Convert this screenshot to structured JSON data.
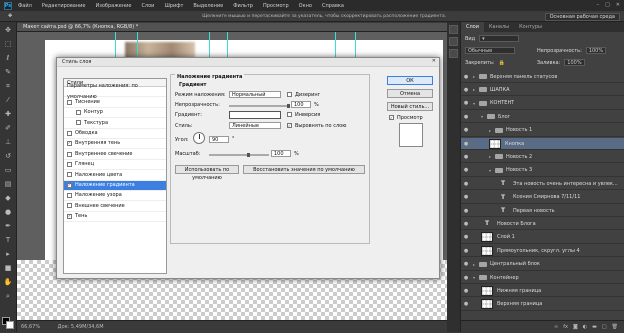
{
  "menu": {
    "logo": "Ps",
    "items": [
      "Файл",
      "Редактирование",
      "Изображение",
      "Слои",
      "Шрифт",
      "Выделение",
      "Фильтр",
      "Просмотр",
      "Окно",
      "Справка"
    ]
  },
  "options_bar": {
    "hint": "Щелкните мышью и перетаскивайте за указатель, чтобы скорректировать расположение градиента.",
    "workspace": "Основная рабочая среда"
  },
  "document": {
    "tab_title": "Макет сайта.psd @ 66,7% (Кнопка, RGB/8) *",
    "zoom": "66,67%",
    "doc_size": "Док: 5,49М/34,6М"
  },
  "panel": {
    "tabs": [
      "Слои",
      "Каналы",
      "Контуры"
    ],
    "kind_label": "Вид",
    "blend_mode": "Обычные",
    "opacity_label": "Непрозрачность:",
    "opacity": "100%",
    "lock_label": "Закрепить:",
    "fill_label": "Заливка:",
    "fill": "100%"
  },
  "layers": [
    {
      "name": "Верхняя панель статусов",
      "type": "folder",
      "level": 0,
      "collapsed": true
    },
    {
      "name": "ШАПКА",
      "type": "folder",
      "level": 0,
      "collapsed": true
    },
    {
      "name": "КОНТЕНТ",
      "type": "folder",
      "level": 0,
      "collapsed": false
    },
    {
      "name": "Блог",
      "type": "folder",
      "level": 1,
      "collapsed": false
    },
    {
      "name": "Новость 1",
      "type": "folder",
      "level": 2,
      "collapsed": true
    },
    {
      "name": "Кнопка",
      "type": "layer",
      "level": 2,
      "selected": true
    },
    {
      "name": "Новость 2",
      "type": "folder",
      "level": 2,
      "collapsed": true
    },
    {
      "name": "Новость 3",
      "type": "folder",
      "level": 2,
      "collapsed": false
    },
    {
      "name": "Эта новость очень интересна и увлек...",
      "type": "text",
      "level": 3
    },
    {
      "name": "Ксения Смирнова 7/11/11",
      "type": "text",
      "level": 3
    },
    {
      "name": "Первая новость",
      "type": "text",
      "level": 3
    },
    {
      "name": "Новости Блога",
      "type": "text",
      "level": 1
    },
    {
      "name": "Слой 1",
      "type": "layer",
      "level": 1
    },
    {
      "name": "Прямоугольник, скругл. углы 4",
      "type": "layer",
      "level": 1
    },
    {
      "name": "Центральный блок",
      "type": "folder",
      "level": 0,
      "collapsed": true
    },
    {
      "name": "Контейнер",
      "type": "folder",
      "level": 0,
      "collapsed": false
    },
    {
      "name": "Нижняя граница",
      "type": "layer",
      "level": 1
    },
    {
      "name": "Верхняя граница",
      "type": "layer",
      "level": 1
    }
  ],
  "dialog": {
    "title": "Стиль слоя",
    "list_header": "Стили",
    "styles": [
      {
        "label": "Параметры наложения: по умолчанию",
        "checkbox": false,
        "checked": false,
        "sub": false
      },
      {
        "label": "Тиснение",
        "checkbox": true,
        "checked": false,
        "sub": false
      },
      {
        "label": "Контур",
        "checkbox": true,
        "checked": false,
        "sub": true
      },
      {
        "label": "Текстура",
        "checkbox": true,
        "checked": false,
        "sub": true
      },
      {
        "label": "Обводка",
        "checkbox": true,
        "checked": false,
        "sub": false
      },
      {
        "label": "Внутренняя тень",
        "checkbox": true,
        "checked": true,
        "sub": false
      },
      {
        "label": "Внутреннее свечение",
        "checkbox": true,
        "checked": false,
        "sub": false
      },
      {
        "label": "Глянец",
        "checkbox": true,
        "checked": false,
        "sub": false
      },
      {
        "label": "Наложение цвета",
        "checkbox": true,
        "checked": false,
        "sub": false
      },
      {
        "label": "Наложение градиента",
        "checkbox": true,
        "checked": true,
        "sub": false,
        "selected": true
      },
      {
        "label": "Наложение узора",
        "checkbox": true,
        "checked": false,
        "sub": false
      },
      {
        "label": "Внешнее свечение",
        "checkbox": true,
        "checked": false,
        "sub": false
      },
      {
        "label": "Тень",
        "checkbox": true,
        "checked": true,
        "sub": false
      }
    ],
    "section_title": "Наложение градиента",
    "group_title": "Градиент",
    "blend_label": "Режим наложения:",
    "blend_value": "Нормальный",
    "dither_label": "Дизеринг",
    "opacity_label": "Непрозрачность:",
    "opacity_value": "100",
    "percent": "%",
    "gradient_label": "Градиент:",
    "inversion_label": "Инверсия",
    "style_label": "Стиль:",
    "style_value": "Линейные",
    "align_label": "Выровнять по слою",
    "angle_label": "Угол:",
    "angle_value": "90",
    "degree": "°",
    "scale_label": "Масштаб:",
    "scale_value": "100",
    "default_btn": "Использовать по умолчанию",
    "reset_btn": "Восстановить значения по умолчанию",
    "ok": "ОК",
    "cancel": "Отмена",
    "new_style": "Новый стиль...",
    "preview_label": "Просмотр"
  },
  "colors": {
    "accent": "#3d7fe0",
    "selected_layer": "#596b85",
    "guide": "#3fdcd2"
  }
}
